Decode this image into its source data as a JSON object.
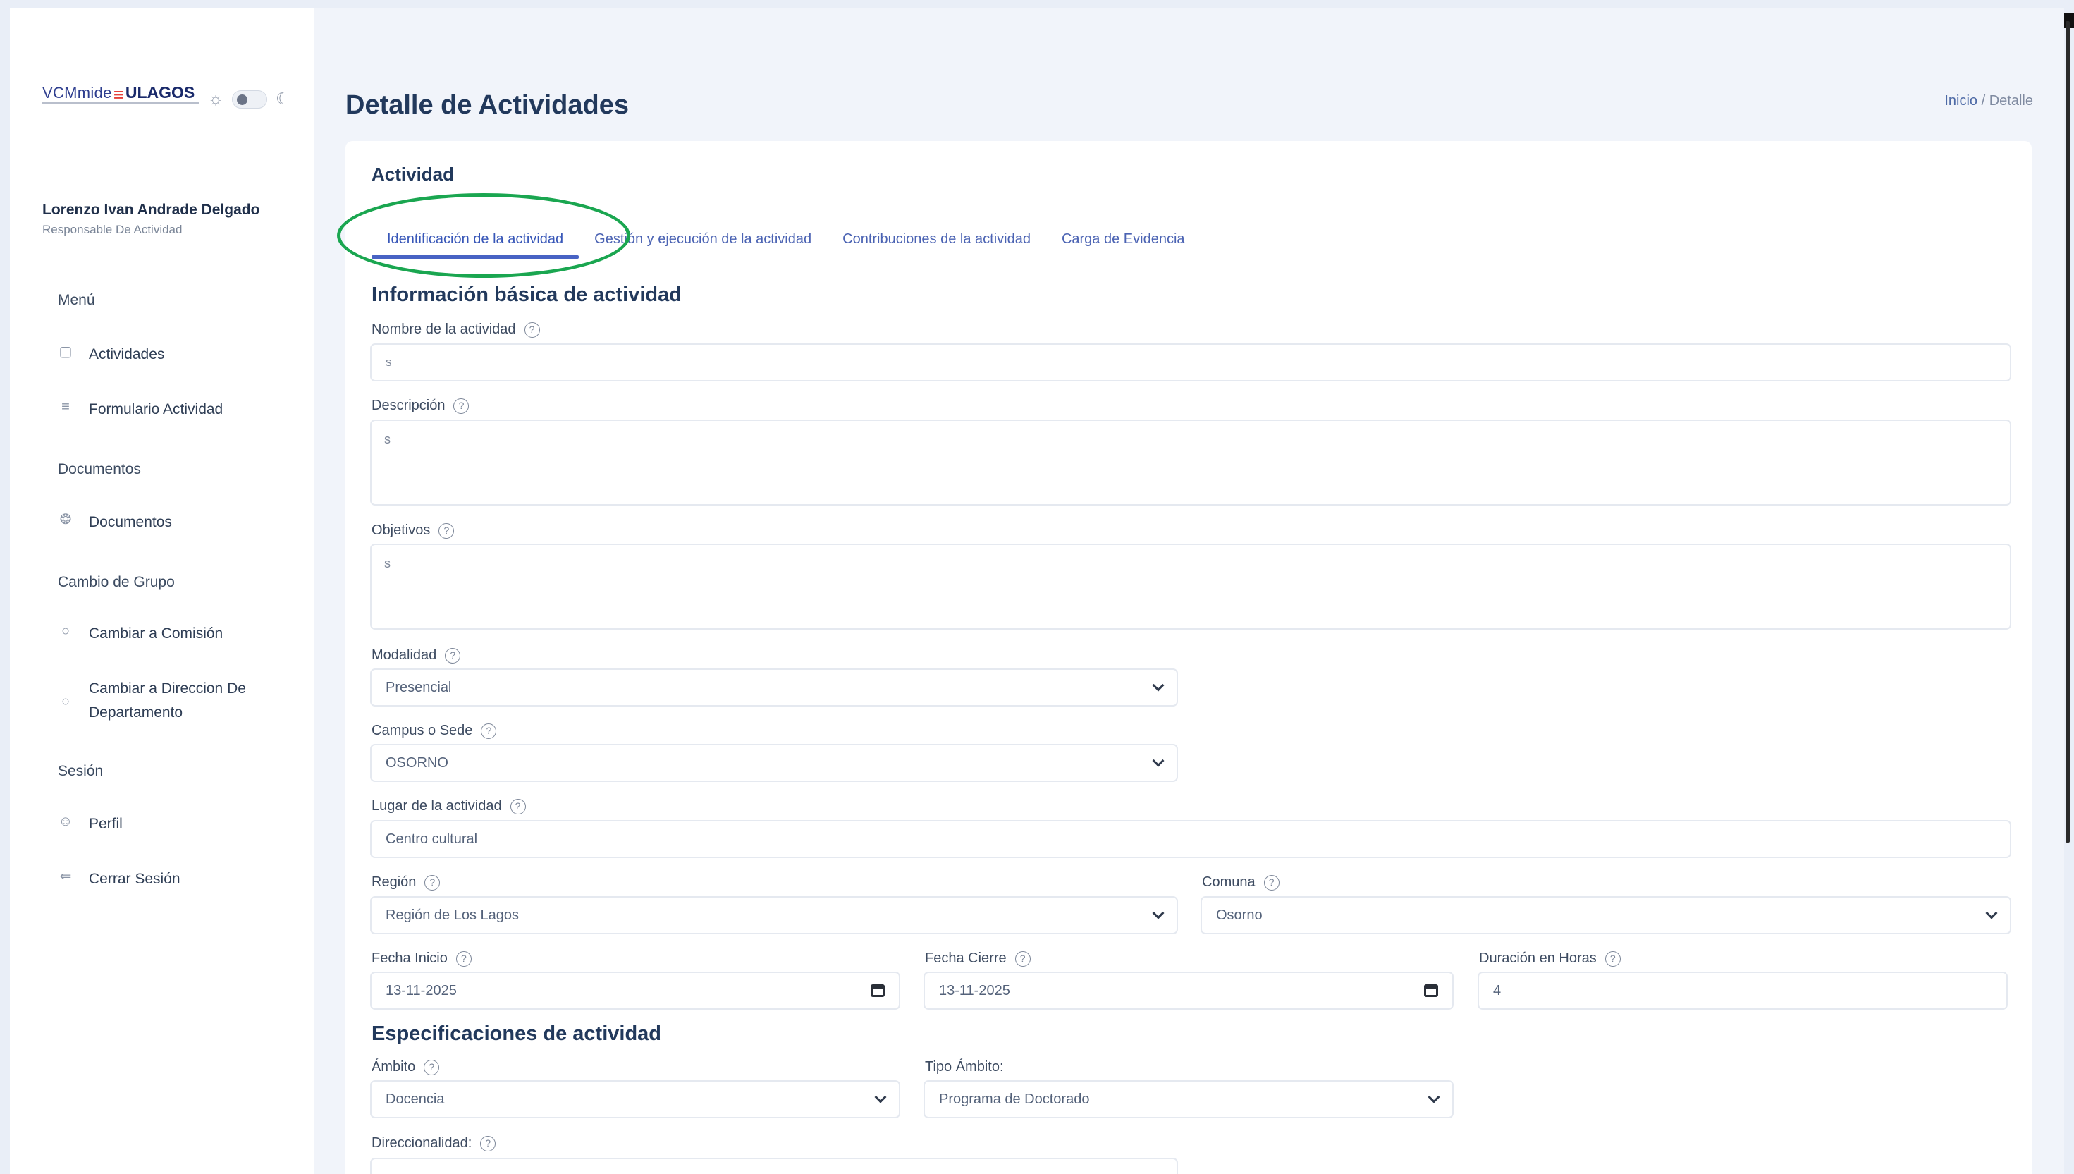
{
  "app": {
    "logo_prefix": "VCMmide",
    "logo_mark": "≡",
    "logo_brand": "ULAGOS",
    "theme_sun_icon": "☼",
    "theme_moon_icon": "☾"
  },
  "user": {
    "name": "Lorenzo Ivan Andrade Delgado",
    "role": "Responsable De Actividad"
  },
  "sidebar": {
    "sections": [
      "Menú",
      "Documentos",
      "Cambio de Grupo",
      "Sesión"
    ],
    "items": [
      {
        "label": "Actividades",
        "icon": "clipboard-icon",
        "glyph": "▢"
      },
      {
        "label": "Formulario Actividad",
        "icon": "list-icon",
        "glyph": "≡"
      },
      {
        "label": "Documentos",
        "icon": "documents-icon",
        "glyph": "❂"
      },
      {
        "label": "Cambiar a Comisión",
        "icon": "circle-icon",
        "glyph": "○"
      },
      {
        "label": "Cambiar a Direccion De",
        "label2": "Departamento",
        "icon": "circle-icon",
        "glyph": "○"
      },
      {
        "label": "Perfil",
        "icon": "user-icon",
        "glyph": "☺"
      },
      {
        "label": "Cerrar Sesión",
        "icon": "logout-icon",
        "glyph": "⇐"
      }
    ]
  },
  "header": {
    "title": "Detalle de Actividades",
    "breadcrumb_home": "Inicio",
    "breadcrumb_sep": "/",
    "breadcrumb_current": "Detalle"
  },
  "card": {
    "title": "Actividad",
    "tabs": [
      "Identificación de la actividad",
      "Gestión y ejecución de la actividad",
      "Contribuciones de la actividad",
      "Carga de Evidencia"
    ],
    "active_tab": 0
  },
  "form": {
    "section_basic": "Información básica de actividad",
    "help_glyph": "?",
    "nombre": {
      "label": "Nombre de la actividad",
      "value": "s"
    },
    "descripcion": {
      "label": "Descripción",
      "value": "s"
    },
    "objetivos": {
      "label": "Objetivos",
      "value": "s"
    },
    "modalidad": {
      "label": "Modalidad",
      "value": "Presencial"
    },
    "campus": {
      "label": "Campus o Sede",
      "value": "OSORNO"
    },
    "lugar": {
      "label": "Lugar de la actividad",
      "value": "Centro cultural"
    },
    "region": {
      "label": "Región",
      "value": "Región de Los Lagos"
    },
    "comuna": {
      "label": "Comuna",
      "value": "Osorno"
    },
    "fecha_inicio": {
      "label": "Fecha Inicio",
      "value": "13-11-2025"
    },
    "fecha_cierre": {
      "label": "Fecha Cierre",
      "value": "13-11-2025"
    },
    "duracion": {
      "label": "Duración en Horas",
      "value": "4"
    },
    "section_specs": "Especificaciones de actividad",
    "ambito": {
      "label": "Ámbito",
      "value": "Docencia"
    },
    "tipo_ambito": {
      "label": "Tipo Ámbito:",
      "value": "Programa de Doctorado"
    },
    "direccionalidad": {
      "label": "Direccionalidad:"
    }
  },
  "colors": {
    "accent": "#4863c4",
    "highlight": "#1aa650",
    "background": "#e9eef7"
  }
}
